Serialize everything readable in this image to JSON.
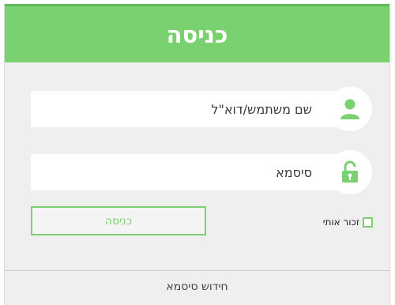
{
  "header": {
    "title": "כניסה"
  },
  "username": {
    "placeholder": "שם משתמש/דוא\"ל",
    "value": ""
  },
  "password": {
    "placeholder": "סיסמא",
    "value": ""
  },
  "login_button": {
    "label": "כניסה"
  },
  "remember_me": {
    "label": "זכור אותי",
    "checked": false
  },
  "forgot_password": {
    "label": "חידוש סיסמא"
  },
  "icons": {
    "user": "user-icon",
    "password": "unlock-icon"
  },
  "colors": {
    "accent": "#79d26f",
    "background": "#efefef"
  }
}
